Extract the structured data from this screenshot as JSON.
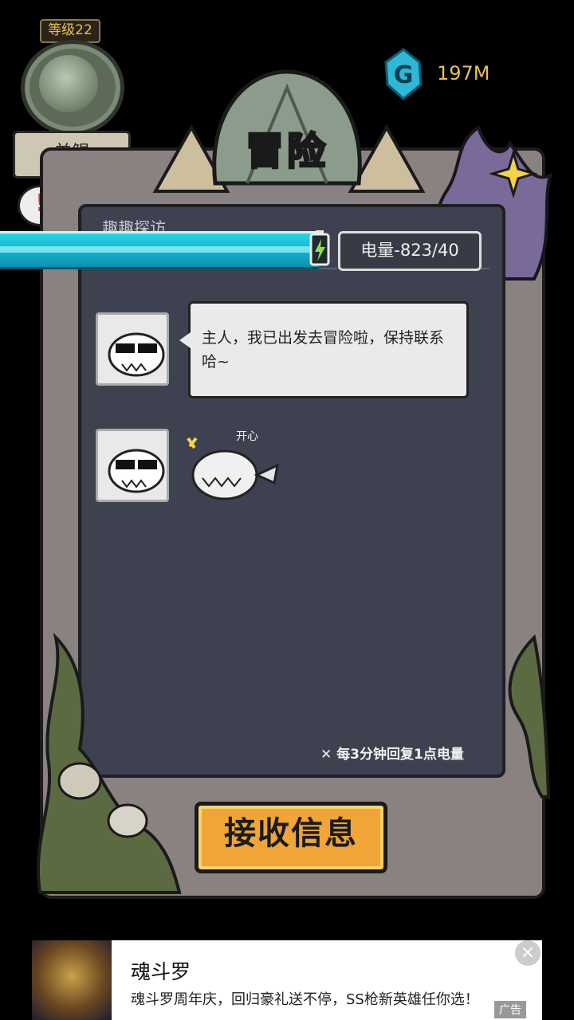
{
  "player": {
    "level": "等级22",
    "name": "羊鲲",
    "alert": "!"
  },
  "currency": {
    "amount": "197M",
    "color": "#e6c255"
  },
  "screen": {
    "title": "冒险",
    "hidden_header": "趣趣探访"
  },
  "energy": {
    "label": "电量-823/40",
    "regen_note": "每3分钟回复1点电量",
    "bar_color": "#28d6e6"
  },
  "chat": {
    "messages": [
      {
        "text": "主人，我已出发去冒险啦，保持联系哈~"
      },
      {
        "sticker_text": "开心"
      }
    ]
  },
  "actions": {
    "receive_label": "接收信息"
  },
  "ad": {
    "title": "魂斗罗",
    "description": "魂斗罗周年庆，回归豪礼送不停，SS枪新英雄任你选！",
    "close_icon": "×",
    "label": "广告"
  }
}
